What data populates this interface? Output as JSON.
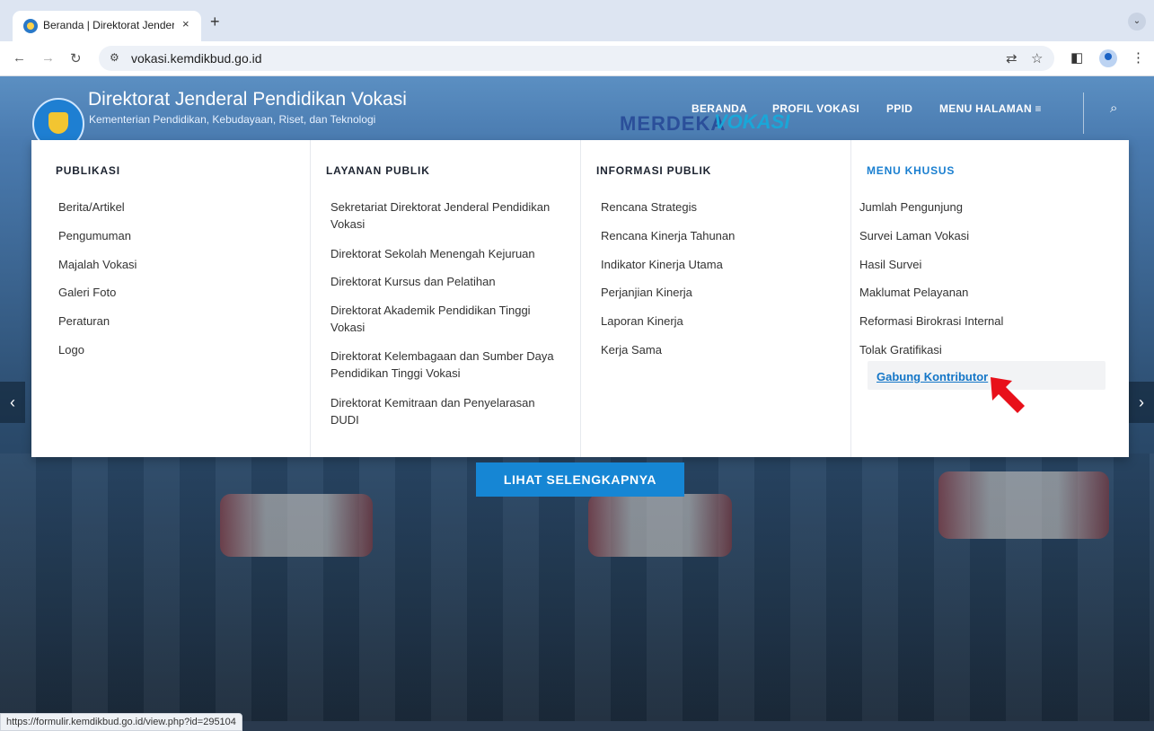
{
  "browser": {
    "tab_title": "Beranda | Direktorat Jenderal",
    "tab_close": "×",
    "new_tab": "+",
    "tab_menu": "⌄",
    "url": "vokasi.kemdikbud.go.id",
    "status_url": "https://formulir.kemdikbud.go.id/view.php?id=295104"
  },
  "header": {
    "title": "Direktorat Jenderal Pendidikan Vokasi",
    "subtitle": "Kementerian Pendidikan, Kebudayaan, Riset, dan Teknologi",
    "banner_text_1": "MERDEKA",
    "banner_text_2": "VOKASI",
    "nav": [
      "BERANDA",
      "PROFIL VOKASI",
      "PPID",
      "MENU HALAMAN ≡"
    ]
  },
  "mega_menu": {
    "publikasi": {
      "heading": "PUBLIKASI",
      "items": [
        "Berita/Artikel",
        "Pengumuman",
        "Majalah Vokasi",
        "Galeri Foto",
        "Peraturan",
        "Logo"
      ]
    },
    "layanan": {
      "heading": "LAYANAN PUBLIK",
      "items": [
        "Sekretariat Direktorat Jenderal Pendidikan Vokasi",
        "Direktorat Sekolah Menengah Kejuruan",
        "Direktorat Kursus dan Pelatihan",
        "Direktorat Akademik Pendidikan Tinggi Vokasi",
        "Direktorat Kelembagaan dan Sumber Daya Pendidikan Tinggi Vokasi",
        "Direktorat Kemitraan dan Penyelarasan DUDI"
      ]
    },
    "informasi": {
      "heading": "INFORMASI PUBLIK",
      "items": [
        "Rencana Strategis",
        "Rencana Kinerja Tahunan",
        "Indikator Kinerja Utama",
        "Perjanjian Kinerja",
        "Laporan Kinerja",
        "Kerja Sama"
      ]
    },
    "khusus": {
      "heading": "MENU KHUSUS",
      "items": [
        "Jumlah Pengunjung",
        "Survei Laman Vokasi",
        "Hasil Survei",
        "Maklumat Pelayanan",
        "Reformasi Birokrasi Internal",
        "Tolak Gratifikasi",
        "Gabung Kontributor"
      ]
    }
  },
  "hero": {
    "cta": "LIHAT SELENGKAPNYA"
  },
  "colors": {
    "accent": "#1686d4",
    "link": "#1476c7",
    "arrow": "#e8101a"
  },
  "icons": [
    "back-icon",
    "forward-icon",
    "reload-icon",
    "site-info-icon",
    "translate-icon",
    "star-icon",
    "sidepanel-icon",
    "profile-icon",
    "more-icon",
    "search-icon"
  ]
}
